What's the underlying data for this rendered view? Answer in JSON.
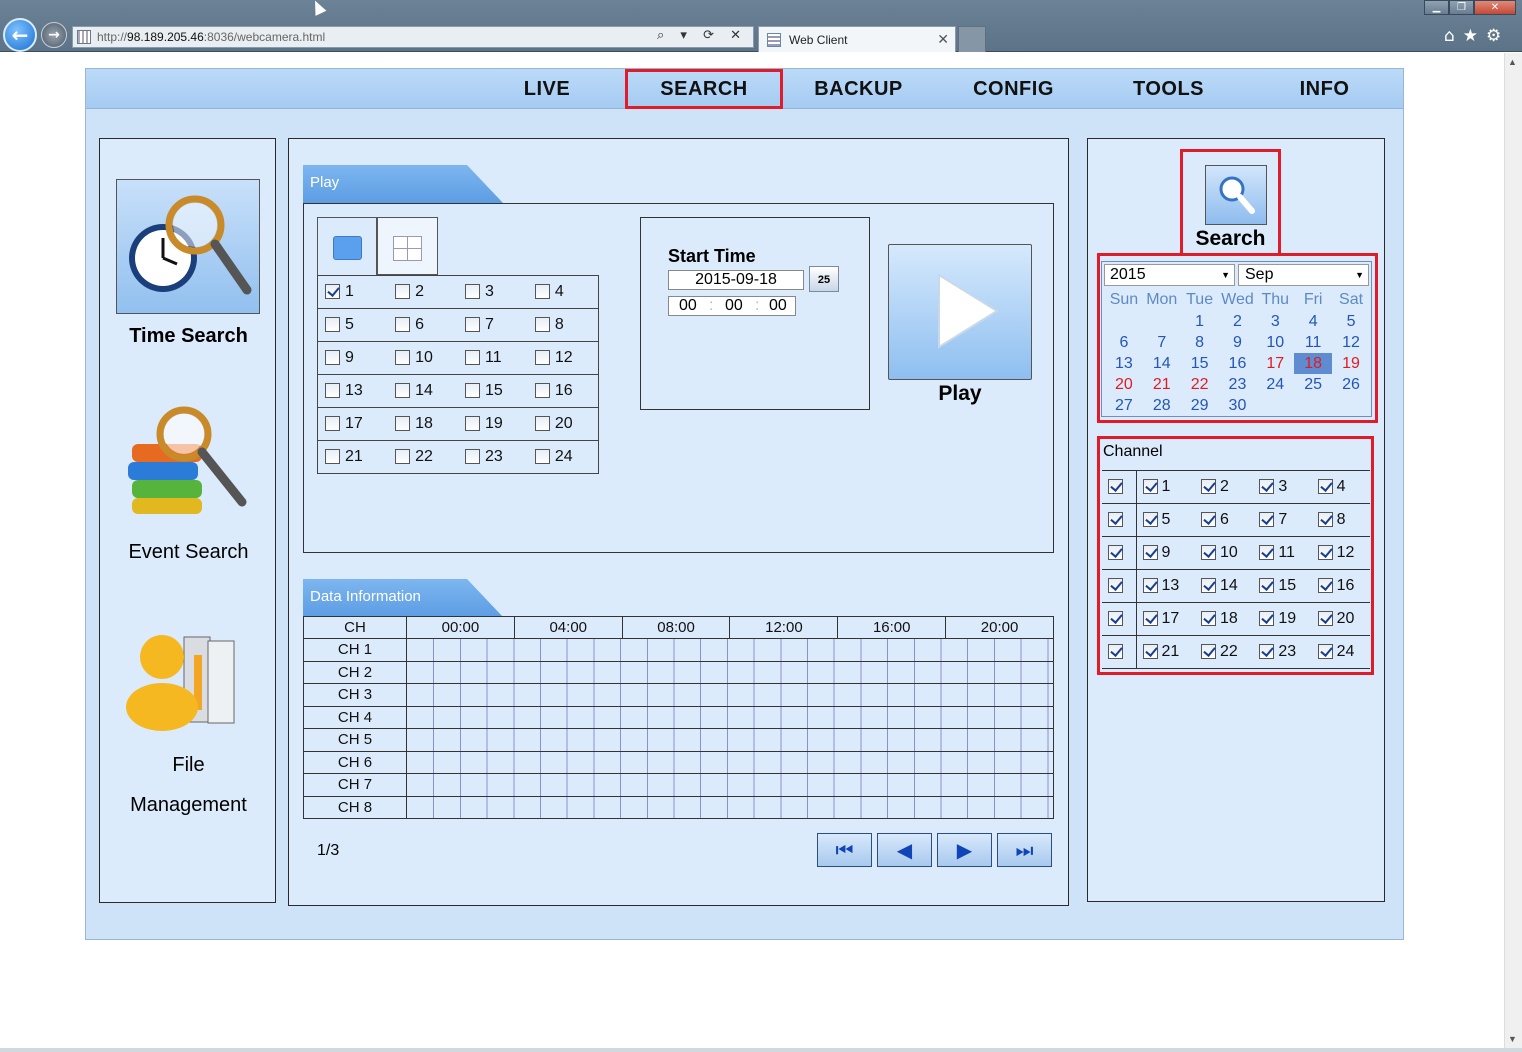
{
  "browser": {
    "url_prefix": "http://",
    "url_host": "98.189.205.46",
    "url_rest": ":8036/webcamera.html",
    "tab_title": "Web Client",
    "url_controls": "⌕ ▾ ⟳ ✕",
    "favorites_icons": "⌂★⚙"
  },
  "topnav": {
    "items": [
      "LIVE",
      "SEARCH",
      "BACKUP",
      "CONFIG",
      "TOOLS",
      "INFO"
    ],
    "active": "SEARCH"
  },
  "left_nav": {
    "time_search": "Time Search",
    "event_search": "Event Search",
    "file_management_line1": "File",
    "file_management_line2": "Management"
  },
  "play_section": {
    "tab_label": "Play",
    "channels": [
      {
        "n": "1",
        "checked": true
      },
      {
        "n": "2",
        "checked": false
      },
      {
        "n": "3",
        "checked": false
      },
      {
        "n": "4",
        "checked": false
      },
      {
        "n": "5",
        "checked": false
      },
      {
        "n": "6",
        "checked": false
      },
      {
        "n": "7",
        "checked": false
      },
      {
        "n": "8",
        "checked": false
      },
      {
        "n": "9",
        "checked": false
      },
      {
        "n": "10",
        "checked": false
      },
      {
        "n": "11",
        "checked": false
      },
      {
        "n": "12",
        "checked": false
      },
      {
        "n": "13",
        "checked": false
      },
      {
        "n": "14",
        "checked": false
      },
      {
        "n": "15",
        "checked": false
      },
      {
        "n": "16",
        "checked": false
      },
      {
        "n": "17",
        "checked": false
      },
      {
        "n": "18",
        "checked": false
      },
      {
        "n": "19",
        "checked": false
      },
      {
        "n": "20",
        "checked": false
      },
      {
        "n": "21",
        "checked": false
      },
      {
        "n": "22",
        "checked": false
      },
      {
        "n": "23",
        "checked": false
      },
      {
        "n": "24",
        "checked": false
      }
    ],
    "start_time_label": "Start Time",
    "date_value": "2015-09-18",
    "calendar_button_label": "25",
    "hour": "00",
    "minute": "00",
    "second": "00",
    "play_label": "Play"
  },
  "data_info": {
    "tab_label": "Data Information",
    "ch_header": "CH",
    "time_headers": [
      "00:00",
      "04:00",
      "08:00",
      "12:00",
      "16:00",
      "20:00"
    ],
    "rows": [
      "CH 1",
      "CH 2",
      "CH 3",
      "CH 4",
      "CH 5",
      "CH 6",
      "CH 7",
      "CH 8"
    ],
    "page": "1/3"
  },
  "right_panel": {
    "search_label": "Search",
    "year": "2015",
    "month": "Sep",
    "weekdays": [
      "Sun",
      "Mon",
      "Tue",
      "Wed",
      "Thu",
      "Fri",
      "Sat"
    ],
    "weeks": [
      [
        "",
        "",
        "1",
        "2",
        "3",
        "4",
        "5"
      ],
      [
        "6",
        "7",
        "8",
        "9",
        "10",
        "11",
        "12"
      ],
      [
        "13",
        "14",
        "15",
        "16",
        "17",
        "18",
        "19"
      ],
      [
        "20",
        "21",
        "22",
        "23",
        "24",
        "25",
        "26"
      ],
      [
        "27",
        "28",
        "29",
        "30",
        "",
        "",
        ""
      ]
    ],
    "red_days": [
      "17",
      "18",
      "19",
      "20",
      "21",
      "22"
    ],
    "selected_day": "18",
    "channel_label": "Channel",
    "channels": [
      "1",
      "2",
      "3",
      "4",
      "5",
      "6",
      "7",
      "8",
      "9",
      "10",
      "11",
      "12",
      "13",
      "14",
      "15",
      "16",
      "17",
      "18",
      "19",
      "20",
      "21",
      "22",
      "23",
      "24"
    ],
    "all_checked": true
  },
  "colors": {
    "highlight_red": "#e01b2a",
    "nav_blue": "#a5cbf2",
    "panel_bg": "#dcebfb",
    "calendar_blue": "#2256b8",
    "calendar_red": "#e01b24"
  }
}
